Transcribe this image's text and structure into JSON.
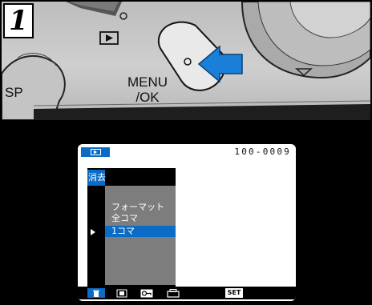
{
  "step": {
    "number": "1"
  },
  "camera": {
    "menu_button_label_line1": "MENU",
    "menu_button_label_line2": "/OK",
    "sp_label": "SP",
    "play_button_icon": "playback-icon"
  },
  "lcd": {
    "frame_number": "100-0009",
    "menu_title": "消去",
    "options": [
      {
        "label": "フォーマット",
        "selected": false
      },
      {
        "label": "全コマ",
        "selected": false
      },
      {
        "label": "1コマ",
        "selected": true
      }
    ],
    "bottom_icons": [
      "erase-icon",
      "dpof-icon",
      "protect-icon",
      "print-icon",
      "set-icon"
    ],
    "set_label": "SET"
  },
  "colors": {
    "accent_blue": "#0a6cc4",
    "arrow_blue": "#1a7fd6",
    "menu_gray": "#7d7d7d"
  }
}
